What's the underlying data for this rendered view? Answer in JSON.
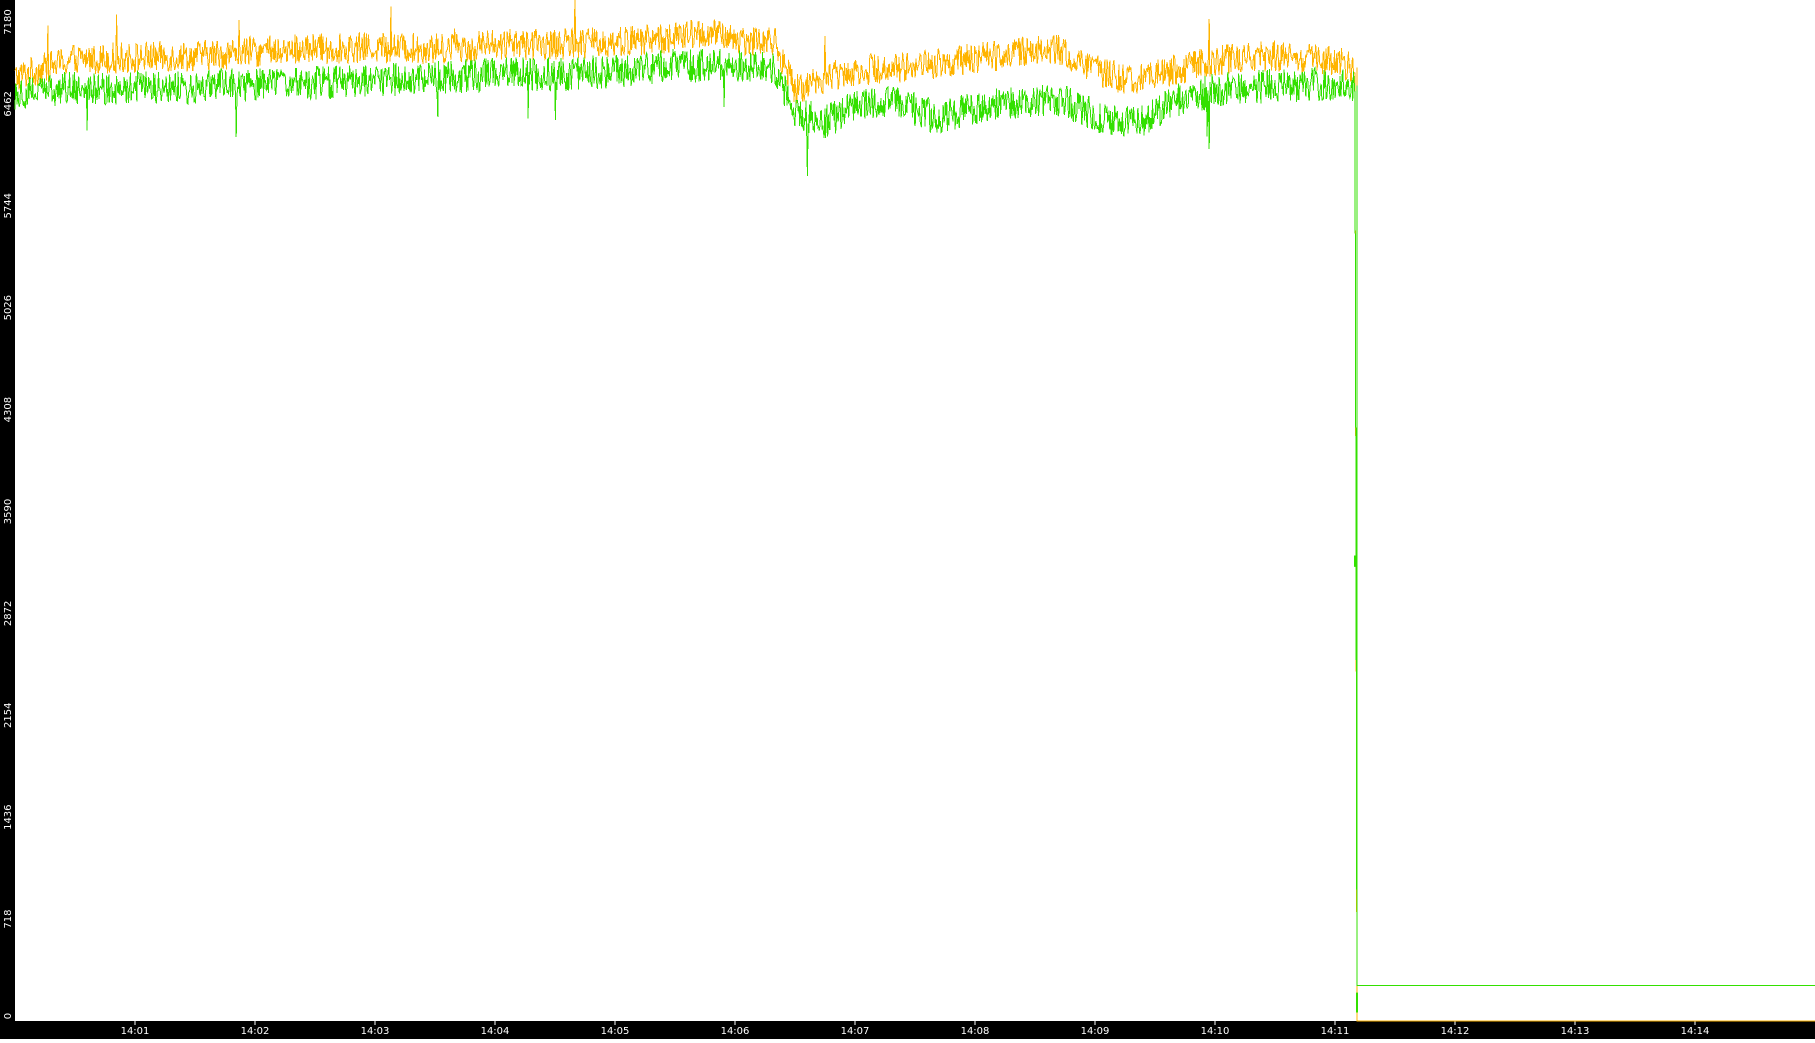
{
  "chart_data": {
    "type": "line",
    "title": "",
    "xlabel": "",
    "ylabel": "",
    "grid": false,
    "legend": "none",
    "background": "#ffffff",
    "axis_color": "#000000",
    "axis_text_color": "#ffffff",
    "ylim": [
      0,
      7180
    ],
    "xlim": [
      "14:00:00",
      "14:15:00"
    ],
    "y_ticks": [
      "0",
      "718",
      "1436",
      "2154",
      "2872",
      "3590",
      "4308",
      "5026",
      "5744",
      "6462",
      "7180"
    ],
    "x_ticks": [
      "14:01",
      "14:02",
      "14:03",
      "14:04",
      "14:05",
      "14:06",
      "14:07",
      "14:08",
      "14:09",
      "14:10",
      "14:11",
      "14:12",
      "14:13",
      "14:14"
    ],
    "series": [
      {
        "color": "#ffb400",
        "x": [
          "14:00:00",
          "14:00:30",
          "14:01:00",
          "14:01:30",
          "14:02:00",
          "14:02:30",
          "14:03:00",
          "14:03:30",
          "14:04:00",
          "14:04:30",
          "14:05:00",
          "14:05:30",
          "14:05:45",
          "14:06:00",
          "14:06:20",
          "14:06:30",
          "14:06:45",
          "14:07:00",
          "14:07:30",
          "14:08:00",
          "14:08:20",
          "14:08:40",
          "14:09:00",
          "14:09:20",
          "14:09:40",
          "14:10:00",
          "14:10:30",
          "14:11:00",
          "14:11:10",
          "14:11:11",
          "14:15:00"
        ],
        "values": [
          6650,
          6780,
          6790,
          6800,
          6830,
          6850,
          6860,
          6850,
          6880,
          6880,
          6900,
          6930,
          6960,
          6920,
          6900,
          6560,
          6650,
          6700,
          6730,
          6780,
          6830,
          6850,
          6700,
          6620,
          6700,
          6770,
          6800,
          6760,
          6720,
          0,
          0
        ],
        "noise": 110,
        "spike_count": 9,
        "spike_height": 260
      },
      {
        "color": "#33e000",
        "x": [
          "14:00:00",
          "14:00:30",
          "14:01:00",
          "14:01:30",
          "14:02:00",
          "14:02:30",
          "14:03:00",
          "14:03:30",
          "14:04:00",
          "14:04:30",
          "14:05:00",
          "14:05:30",
          "14:06:00",
          "14:06:20",
          "14:06:30",
          "14:06:45",
          "14:07:00",
          "14:07:20",
          "14:07:40",
          "14:08:00",
          "14:08:20",
          "14:08:40",
          "14:09:00",
          "14:09:20",
          "14:09:40",
          "14:10:00",
          "14:10:30",
          "14:11:00",
          "14:11:10",
          "14:11:11",
          "14:15:00"
        ],
        "values": [
          6540,
          6580,
          6570,
          6580,
          6600,
          6610,
          6630,
          6650,
          6670,
          6670,
          6690,
          6730,
          6740,
          6700,
          6400,
          6330,
          6450,
          6480,
          6370,
          6430,
          6470,
          6500,
          6380,
          6320,
          6480,
          6560,
          6590,
          6600,
          6590,
          250,
          250
        ],
        "noise": 120,
        "spike_count": 16,
        "spike_height": -330,
        "marks": [
          {
            "x": "14:11:10",
            "value": 3240,
            "span": 80
          },
          {
            "x": "14:11:11",
            "value": 130,
            "span": 140
          }
        ]
      }
    ]
  }
}
